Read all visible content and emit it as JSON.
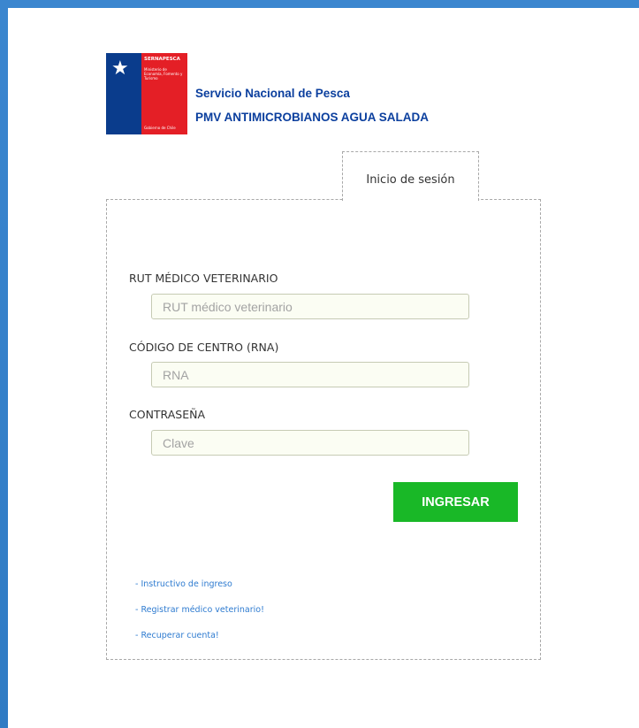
{
  "header": {
    "logo": {
      "title": "SERNAPESCA",
      "subtitle": "Ministerio de Economía, Fomento y Turismo",
      "footer": "Gobierno de Chile"
    },
    "organization": "Servicio Nacional de Pesca",
    "system": "PMV ANTIMICROBIANOS AGUA SALADA"
  },
  "tab": {
    "label": "Inicio de sesión"
  },
  "form": {
    "rut": {
      "label": "RUT MÉDICO VETERINARIO",
      "placeholder": "RUT médico veterinario"
    },
    "rna": {
      "label": "CÓDIGO DE CENTRO (RNA)",
      "placeholder": "RNA"
    },
    "password": {
      "label": "CONTRASEÑA",
      "placeholder": "Clave"
    },
    "submit_label": "INGRESAR"
  },
  "links": [
    "- Instructivo de ingreso",
    "- Registrar médico veterinario!",
    "- Recuperar cuenta!"
  ],
  "colors": {
    "background": "#2f7bc4",
    "brand_blue": "#0b3f9e",
    "logo_blue": "#0a3c8c",
    "logo_red": "#e41f26",
    "button_green": "#19b827",
    "link": "#2e7bd0"
  }
}
